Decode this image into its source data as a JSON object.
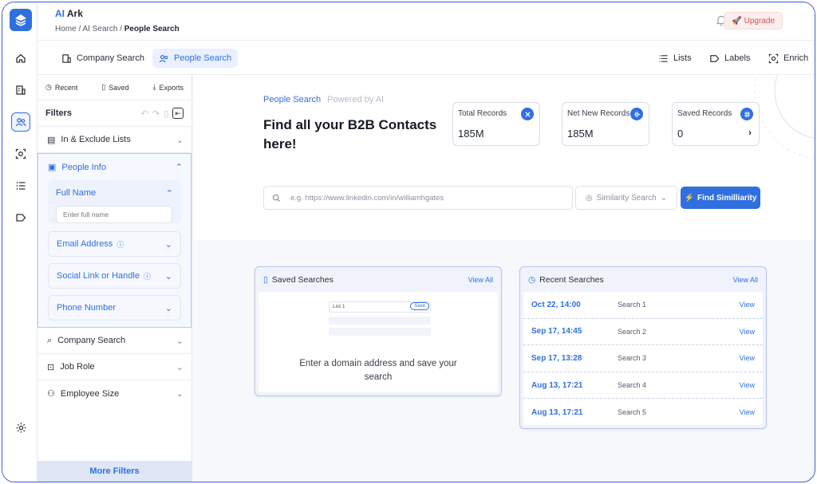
{
  "header": {
    "brand_prefix": "AI",
    "brand_suffix": " Ark",
    "breadcrumb": [
      "Home",
      "AI Search",
      "People Search"
    ],
    "upgrade_label": "Upgrade"
  },
  "subnav": {
    "company_search": "Company Search",
    "people_search": "People Search",
    "lists": "Lists",
    "labels": "Labels",
    "enrich": "Enrich"
  },
  "filters": {
    "tabs": {
      "recent": "Recent",
      "saved": "Saved",
      "exports": "Exports"
    },
    "title": "Filters",
    "include_exclude": "In & Exclude Lists",
    "people_info": "People Info",
    "full_name": "Full Name",
    "full_name_placeholder": "Enter full name",
    "email": "Email Address",
    "social": "Social Link or Handle",
    "phone": "Phone Number",
    "company_search": "Company Search",
    "job_role": "Job Role",
    "employee_size": "Employee Size",
    "more_filters": "More Filters"
  },
  "main": {
    "title": "People Search",
    "powered": "Powered by AI",
    "headline": "Find all your B2B Contacts here!",
    "stats": [
      {
        "label": "Total Records",
        "value": "185M"
      },
      {
        "label": "Net New Records",
        "value": "185M"
      },
      {
        "label": "Saved Records",
        "value": "0"
      }
    ],
    "search_placeholder": "e.g. https://www.linkedin.com/in/williamhgates",
    "similarity_label": "Similarity Search",
    "find_button": "Find Similliarity"
  },
  "saved_searches": {
    "title": "Saved Searches",
    "view_all": "View All",
    "illustration_list": "List 1",
    "illustration_save": "Save",
    "empty_text": "Enter a domain address and save your search"
  },
  "recent_searches": {
    "title": "Recent Searches",
    "view_all": "View All",
    "rows": [
      {
        "date": "Oct 22, 14:00",
        "name": "Search 1",
        "action": "View"
      },
      {
        "date": "Sep 17, 14:45",
        "name": "Search 2",
        "action": "View"
      },
      {
        "date": "Sep 17, 13:28",
        "name": "Search 3",
        "action": "View"
      },
      {
        "date": "Aug 13, 17:21",
        "name": "Search 4",
        "action": "View"
      },
      {
        "date": "Aug 13, 17:21",
        "name": "Search 5",
        "action": "View"
      }
    ]
  },
  "colors": {
    "accent": "#2f6fe0",
    "upgrade": "#d9504f"
  }
}
